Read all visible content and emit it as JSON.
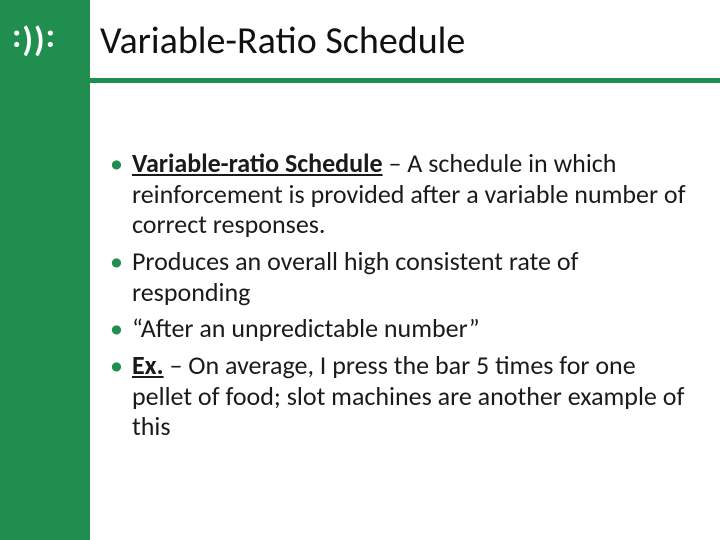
{
  "logo": {
    "glyphs": ": ) ) :"
  },
  "title": "Variable-Ratio Schedule",
  "bullets": [
    {
      "term": "Variable-ratio Schedule",
      "sep": " – ",
      "rest": "A schedule in which reinforcement is provided after a variable number of correct responses."
    },
    {
      "text": "Produces an overall high consistent rate of responding"
    },
    {
      "text": "“After an unpredictable number”"
    },
    {
      "ex": "Ex.",
      "sep": " – ",
      "rest": "On average, I press the bar 5 times for one pellet of food; slot machines are another example of this"
    }
  ]
}
